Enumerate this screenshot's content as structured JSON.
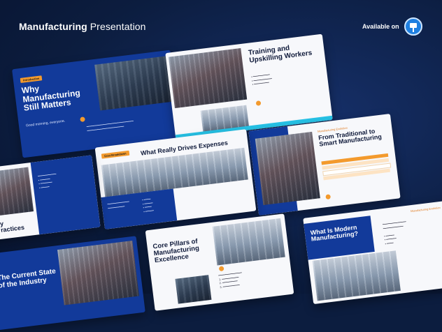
{
  "header": {
    "title_bold": "Manufacturing",
    "title_rest": " Presentation",
    "available": "Available on",
    "app_icon": "keynote-icon"
  },
  "slides": {
    "why": {
      "tag": "Introduction",
      "title_1": "Why",
      "title_2": "Manufacturing",
      "title_3": "Still Matters",
      "greeting": "Good morning, everyone."
    },
    "training": {
      "title_1": "Training and",
      "title_2": "Upskilling Workers"
    },
    "traditional": {
      "label": "Manufacturing Evolution",
      "title_1": "From Traditional to",
      "title_2": "Smart Manufacturing",
      "rows": [
        "Traditional",
        "Smart"
      ]
    },
    "drives": {
      "tag": "Cost Breakdown",
      "title": "What Really Drives Expenses"
    },
    "practices": {
      "title": "y\nractices"
    },
    "pillars": {
      "title_1": "Core Pillars of",
      "title_2": "Manufacturing",
      "title_3": "Excellence"
    },
    "modern": {
      "label": "Manufacturing Evolution",
      "title_1": "What Is Modern",
      "title_2": "Manufacturing?"
    },
    "current": {
      "title_1": "The Current State",
      "title_2": "of the Industry"
    }
  }
}
